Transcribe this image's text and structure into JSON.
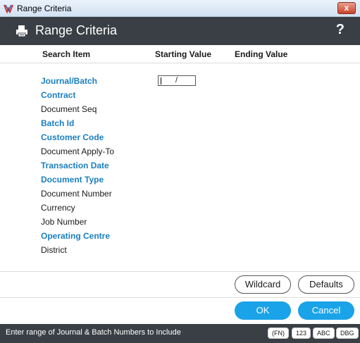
{
  "window": {
    "title": "Range Criteria",
    "close_label": "x"
  },
  "header": {
    "title": "Range Criteria",
    "help_label": "?"
  },
  "columns": {
    "search_item": "Search Item",
    "starting_value": "Starting Value",
    "ending_value": "Ending Value"
  },
  "items": [
    {
      "label": "Journal/Batch",
      "required": true
    },
    {
      "label": "Contract",
      "required": true
    },
    {
      "label": "Document Seq",
      "required": false
    },
    {
      "label": "Batch Id",
      "required": true
    },
    {
      "label": "Customer Code",
      "required": true
    },
    {
      "label": "Document Apply-To",
      "required": false
    },
    {
      "label": "Transaction Date",
      "required": true
    },
    {
      "label": "Document Type",
      "required": true
    },
    {
      "label": "Document Number",
      "required": false
    },
    {
      "label": "Currency",
      "required": false
    },
    {
      "label": "Job Number",
      "required": false
    },
    {
      "label": "Operating Centre",
      "required": true
    },
    {
      "label": "District",
      "required": false
    }
  ],
  "range_input": {
    "separator": "/"
  },
  "buttons": {
    "wildcard": "Wildcard",
    "defaults": "Defaults",
    "ok": "OK",
    "cancel": "Cancel"
  },
  "status": {
    "message": "Enter range of Journal & Batch Numbers to Include",
    "badges": [
      "(FN)",
      "123",
      "ABC",
      "DBG"
    ]
  },
  "colors": {
    "header_bg": "#3a3f45",
    "required_label": "#1a7fc0",
    "primary_button": "#1aa3e8"
  }
}
